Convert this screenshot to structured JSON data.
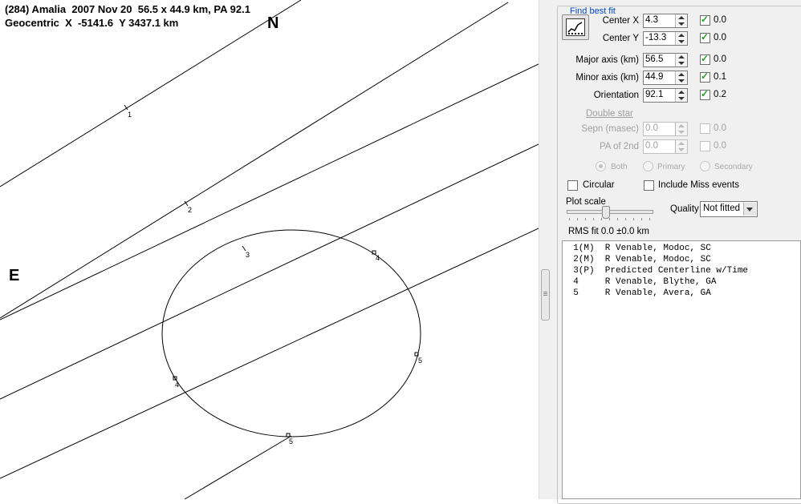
{
  "plot": {
    "header_line1": "(284) Amalia  2007 Nov 20  56.5 x 44.9 km, PA 92.1",
    "header_line2": "Geocentric  X  -5141.6  Y 3437.1 km",
    "north_label": "N",
    "east_label": "E",
    "chord_labels": [
      "1",
      "2",
      "3",
      "4",
      "5"
    ]
  },
  "panel": {
    "group_title": "Find best fit",
    "center_x": {
      "label": "Center X",
      "value": "4.3",
      "checked": true,
      "uncertainty": "0.0"
    },
    "center_y": {
      "label": "Center Y",
      "value": "-13.3",
      "checked": true,
      "uncertainty": "0.0"
    },
    "major_axis": {
      "label": "Major axis (km)",
      "value": "56.5",
      "checked": true,
      "uncertainty": "0.0"
    },
    "minor_axis": {
      "label": "Minor axis (km)",
      "value": "44.9",
      "checked": true,
      "uncertainty": "0.1"
    },
    "orientation": {
      "label": "Orientation",
      "value": "92.1",
      "checked": true,
      "uncertainty": "0.2"
    },
    "double_star": {
      "heading": "Double star",
      "sepn": {
        "label": "Sepn (masec)",
        "value": "0.0",
        "uncertainty": "0.0"
      },
      "pa2": {
        "label": "PA of 2nd",
        "value": "0.0",
        "uncertainty": "0.0"
      },
      "radios": [
        "Both",
        "Primary",
        "Secondary"
      ]
    },
    "circular_label": "Circular",
    "include_miss_label": "Include Miss events",
    "plot_scale_label": "Plot scale",
    "quality_label": "Quality",
    "quality_value": "Not fitted",
    "rms_fit": "RMS fit 0.0 ±0.0 km",
    "events": [
      "  1(M)  R Venable, Modoc, SC",
      "  2(M)  R Venable, Modoc, SC",
      "  3(P)  Predicted Centerline w/Time",
      "  4     R Venable, Blythe, GA",
      "  5     R Venable, Avera, GA"
    ]
  },
  "colors": {
    "group_title": "#0046d5",
    "check_mark": "#21a121",
    "panel_bg": "#f0f0f0"
  }
}
